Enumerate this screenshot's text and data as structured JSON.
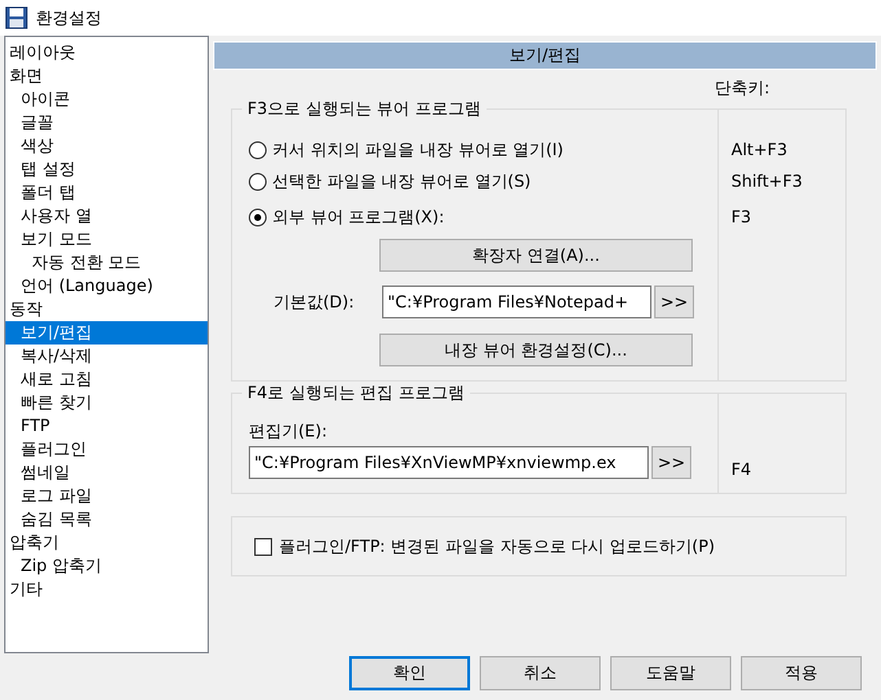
{
  "window": {
    "title": "환경설정"
  },
  "sidebar": {
    "items": [
      {
        "label": "레이아웃",
        "selected": false
      },
      {
        "label": "화면",
        "selected": false,
        "children": [
          {
            "label": "아이콘",
            "selected": false
          },
          {
            "label": "글꼴",
            "selected": false
          },
          {
            "label": "색상",
            "selected": false
          },
          {
            "label": "탭 설정",
            "selected": false
          },
          {
            "label": "폴더 탭",
            "selected": false
          },
          {
            "label": "사용자 열",
            "selected": false
          },
          {
            "label": "보기 모드",
            "selected": false,
            "children": [
              {
                "label": "자동 전환 모드",
                "selected": false
              }
            ]
          },
          {
            "label": "언어 (Language)",
            "selected": false
          }
        ]
      },
      {
        "label": "동작",
        "selected": false,
        "children": [
          {
            "label": "보기/편집",
            "selected": true
          },
          {
            "label": "복사/삭제",
            "selected": false
          },
          {
            "label": "새로 고침",
            "selected": false
          },
          {
            "label": "빠른 찾기",
            "selected": false
          },
          {
            "label": "FTP",
            "selected": false
          },
          {
            "label": "플러그인",
            "selected": false
          },
          {
            "label": "썸네일",
            "selected": false
          },
          {
            "label": "로그 파일",
            "selected": false
          },
          {
            "label": "숨김 목록",
            "selected": false
          }
        ]
      },
      {
        "label": "압축기",
        "selected": false,
        "children": [
          {
            "label": "Zip 압축기",
            "selected": false
          }
        ]
      },
      {
        "label": "기타",
        "selected": false
      }
    ]
  },
  "panel": {
    "header": "보기/편집",
    "shortcut_header": "단축키:",
    "viewer_group": {
      "title": "F3으로 실행되는 뷰어 프로그램",
      "options": [
        {
          "label": "커서 위치의 파일을 내장 뷰어로 열기(I)",
          "selected": false,
          "shortcut": "Alt+F3"
        },
        {
          "label": "선택한 파일을 내장 뷰어로 열기(S)",
          "selected": false,
          "shortcut": "Shift+F3"
        },
        {
          "label": "외부 뷰어 프로그램(X):",
          "selected": true,
          "shortcut": "F3"
        }
      ],
      "associate_button": "확장자 연결(A)...",
      "default_label": "기본값(D):",
      "default_value": "\"C:¥Program Files¥Notepad+",
      "browse_button": ">>",
      "settings_button": "내장 뷰어 환경설정(C)..."
    },
    "editor_group": {
      "title": "F4로 실행되는 편집 프로그램",
      "label": "편집기(E):",
      "value": "\"C:¥Program Files¥XnViewMP¥xnviewmp.ex",
      "browse_button": ">>",
      "shortcut": "F4"
    },
    "plugin_checkbox": {
      "label": "플러그인/FTP: 변경된 파일을 자동으로 다시 업로드하기(P)",
      "checked": false
    }
  },
  "buttons": [
    {
      "label": "확인",
      "default": true
    },
    {
      "label": "취소",
      "default": false
    },
    {
      "label": "도움말",
      "default": false
    },
    {
      "label": "적용",
      "default": false
    }
  ]
}
